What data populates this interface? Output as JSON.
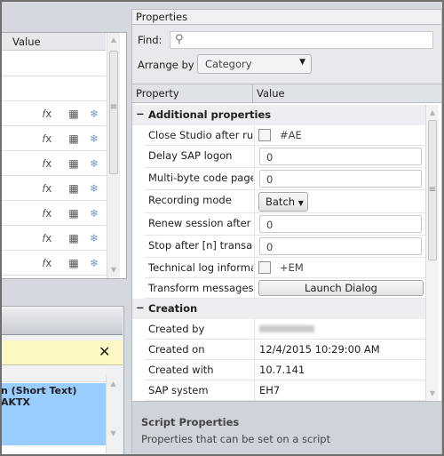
{
  "left_table": {
    "value_header": "Value",
    "row_icons": [
      "function-gear-icon",
      "numbered-list-icon",
      "snowflake-icon"
    ],
    "icon_rows": 7
  },
  "left_lower": {
    "close_label": "✕",
    "selected_line1": "n (Short Text)",
    "selected_line2": "AKTX",
    "selection_color": "#99ccff",
    "banner_color": "#fbf8c4"
  },
  "properties": {
    "title": "Properties",
    "find_label": "Find:",
    "find_value": "",
    "arrange_label": "Arrange by",
    "arrange_value": "Category",
    "col_property": "Property",
    "col_value": "Value",
    "groups": [
      {
        "label": "Additional properties",
        "rows": [
          {
            "name": "Close Studio after run",
            "type": "checkbox",
            "checked": false,
            "value": "#AE"
          },
          {
            "name": "Delay SAP logon",
            "type": "text",
            "value": "0"
          },
          {
            "name": "Multi-byte code page",
            "type": "text",
            "value": "0"
          },
          {
            "name": "Recording mode",
            "type": "dropdown",
            "value": "Batch"
          },
          {
            "name": "Renew session after [n",
            "type": "text",
            "value": "0"
          },
          {
            "name": "Stop after [n] transacti",
            "type": "text",
            "value": "0"
          },
          {
            "name": "Technical log informat",
            "type": "checkbox",
            "checked": false,
            "value": "+EM"
          },
          {
            "name": "Transform messages",
            "type": "button",
            "value": "Launch Dialog"
          }
        ]
      },
      {
        "label": "Creation",
        "rows": [
          {
            "name": "Created by",
            "type": "blurred",
            "value": ""
          },
          {
            "name": "Created on",
            "type": "static",
            "value": "12/4/2015 10:29:00 AM"
          },
          {
            "name": "Created with",
            "type": "static",
            "value": "10.7.141"
          },
          {
            "name": "SAP system",
            "type": "static",
            "value": "EH7"
          }
        ]
      }
    ],
    "description_title": "Script Properties",
    "description_text": "Properties that can be set on a script"
  }
}
